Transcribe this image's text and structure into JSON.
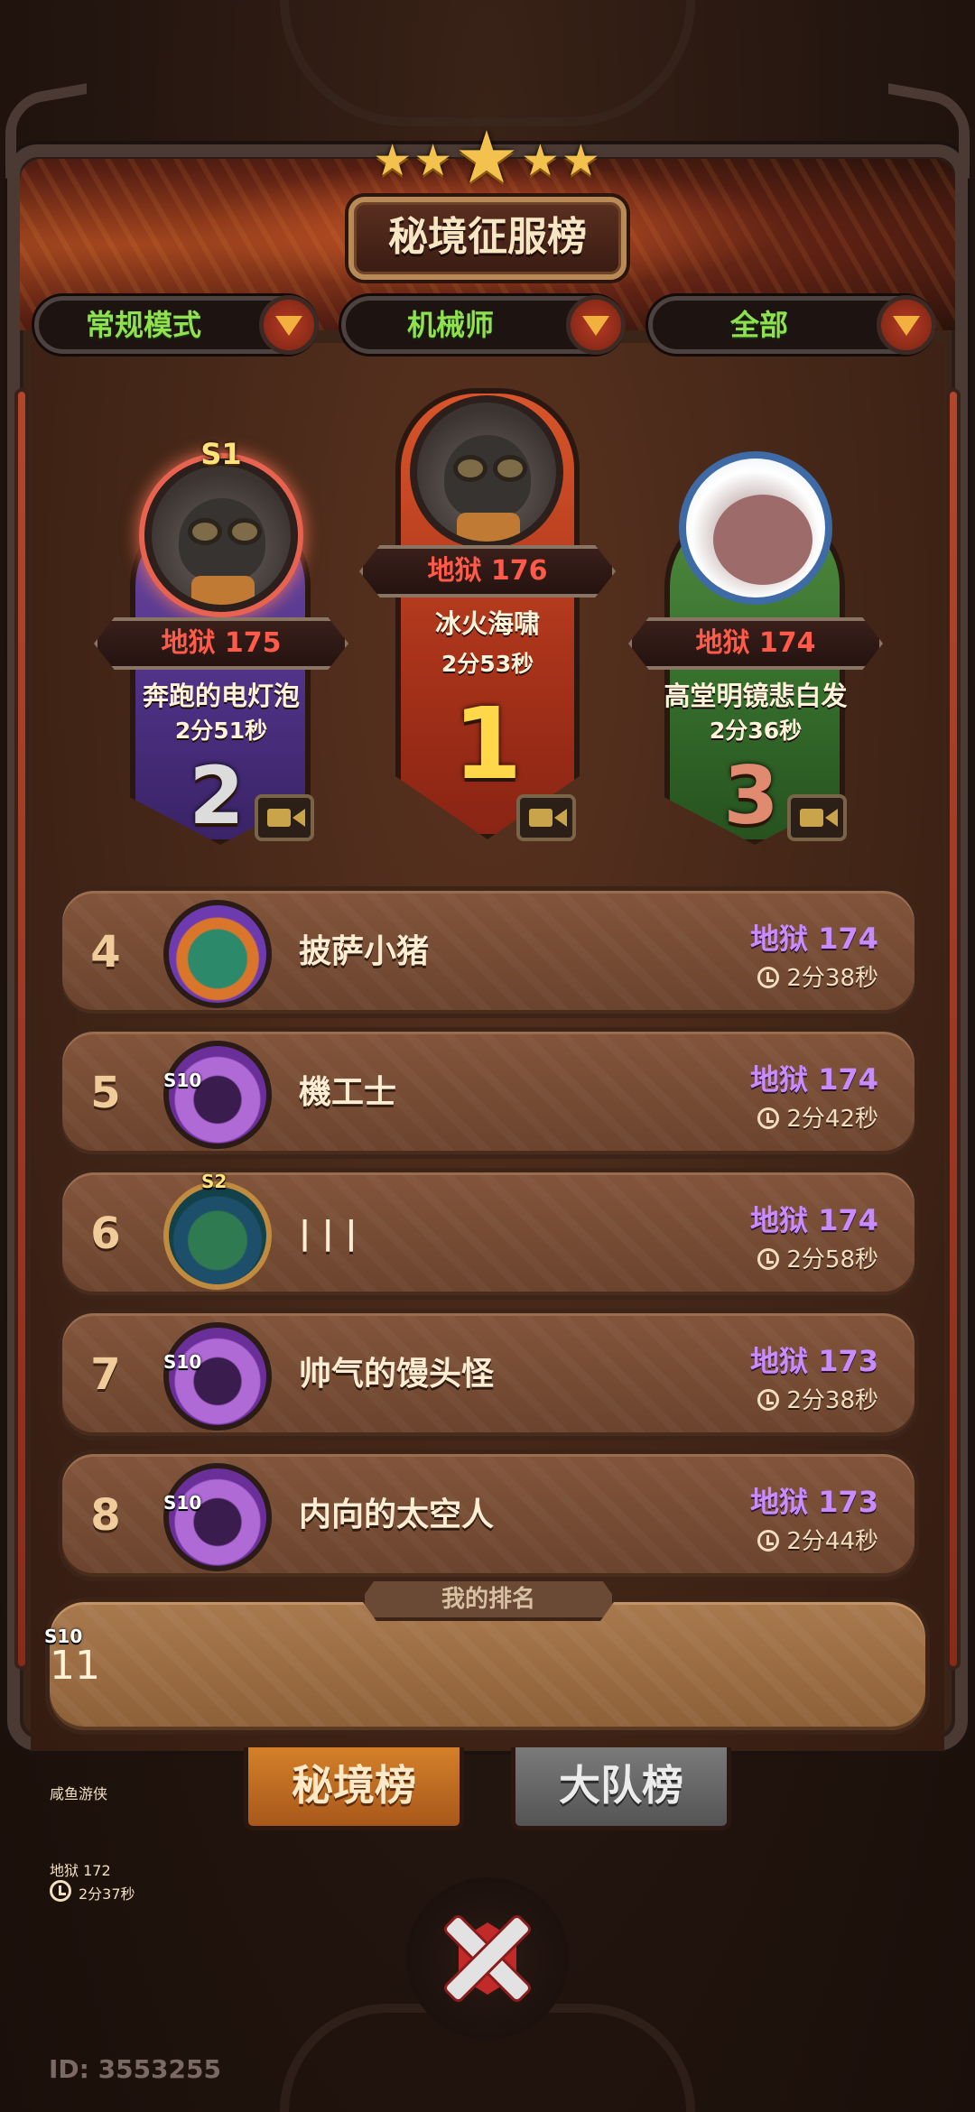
{
  "header": {
    "title": "秘境征服榜",
    "stars": 5
  },
  "filters": [
    {
      "label": "常规模式"
    },
    {
      "label": "机械师"
    },
    {
      "label": "全部"
    }
  ],
  "podium": {
    "first": {
      "rank": "1",
      "score": "地狱 176",
      "name": "冰火海啸",
      "time": "2分53秒"
    },
    "second": {
      "rank": "2",
      "score": "地狱 175",
      "name": "奔跑的电灯泡",
      "time": "2分51秒",
      "season": "S1"
    },
    "third": {
      "rank": "3",
      "score": "地狱 174",
      "name": "高堂明镜悲白发",
      "time": "2分36秒"
    }
  },
  "list": [
    {
      "rank": "4",
      "name": "披萨小猪",
      "score": "地狱 174",
      "time": "2分38秒"
    },
    {
      "rank": "5",
      "name": "機工士",
      "score": "地狱 174",
      "time": "2分42秒",
      "season": "S10"
    },
    {
      "rank": "6",
      "name": "| | |",
      "score": "地狱 174",
      "time": "2分58秒",
      "season": "S2"
    },
    {
      "rank": "7",
      "name": "帅气的馒头怪",
      "score": "地狱 173",
      "time": "2分38秒",
      "season": "S10"
    },
    {
      "rank": "8",
      "name": "内向的太空人",
      "score": "地狱 173",
      "time": "2分44秒",
      "season": "S10"
    }
  ],
  "my_rank": {
    "label": "我的排名",
    "rank": "11",
    "name": "咸鱼游侠",
    "score": "地狱 172",
    "time": "2分37秒",
    "season": "S10"
  },
  "tabs": {
    "active": "秘境榜",
    "inactive": "大队榜"
  },
  "footer": {
    "user_id": "ID: 3553255"
  },
  "colors": {
    "score_red": "#ff5a4a",
    "score_purple": "#c98cff",
    "filter_green": "#8fe14f"
  }
}
